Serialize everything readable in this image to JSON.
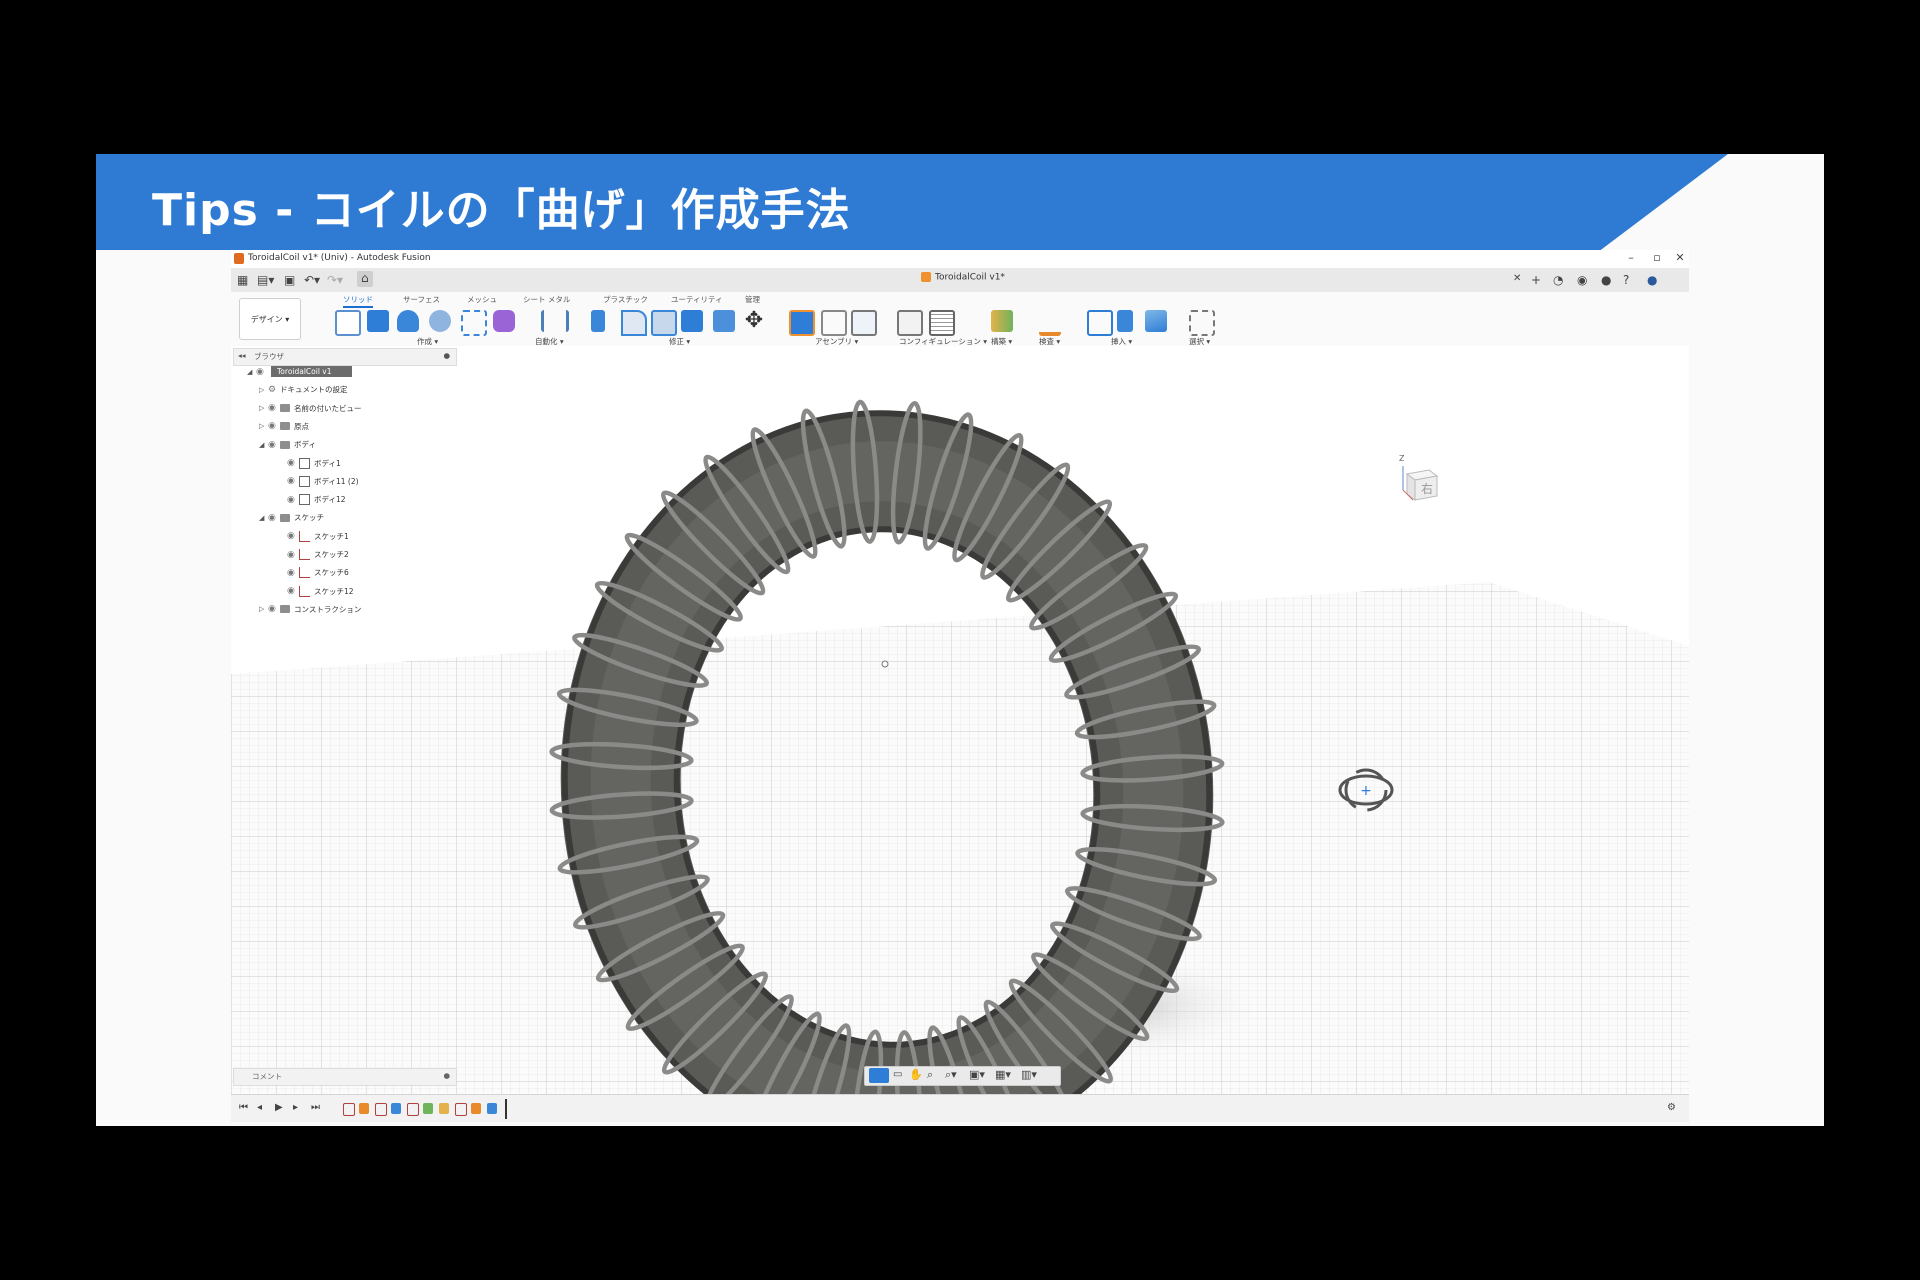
{
  "slide": {
    "title": "Tips - コイルの「曲げ」作成手法",
    "banner_color": "#2f7bd3"
  },
  "app": {
    "window_title": "ToroidalCoil v1* (Univ) - Autodesk Fusion",
    "document_tab": "ToroidalCoil v1*",
    "workspace": "デザイン ▾",
    "ribbon_tabs": [
      "ソリッド",
      "サーフェス",
      "メッシュ",
      "シート メタル",
      "プラスチック",
      "ユーティリティ",
      "管理"
    ],
    "active_tab": "ソリッド",
    "ribbon_groups": [
      "作成 ▾",
      "自動化 ▾",
      "修正 ▾",
      "アセンブリ ▾",
      "コンフィギュレーション ▾",
      "構築 ▾",
      "検査 ▾",
      "挿入 ▾",
      "選択 ▾"
    ]
  },
  "browser": {
    "header": "ブラウザ",
    "root": "ToroidalCoil v1",
    "items": [
      {
        "label": "ドキュメントの設定",
        "level": 1,
        "icon": "gear-icon"
      },
      {
        "label": "名前の付いたビュー",
        "level": 1,
        "icon": "folder-icon"
      },
      {
        "label": "原点",
        "level": 1,
        "icon": "folder-icon"
      },
      {
        "label": "ボディ",
        "level": 1,
        "icon": "folder-icon"
      },
      {
        "label": "ボディ1",
        "level": 2,
        "icon": "body-icon"
      },
      {
        "label": "ボディ11 (2)",
        "level": 2,
        "icon": "body-icon"
      },
      {
        "label": "ボディ12",
        "level": 2,
        "icon": "body-icon"
      },
      {
        "label": "スケッチ",
        "level": 1,
        "icon": "folder-icon"
      },
      {
        "label": "スケッチ1",
        "level": 2,
        "icon": "sketch-icon"
      },
      {
        "label": "スケッチ2",
        "level": 2,
        "icon": "sketch-icon"
      },
      {
        "label": "スケッチ6",
        "level": 2,
        "icon": "sketch-icon"
      },
      {
        "label": "スケッチ12",
        "level": 2,
        "icon": "sketch-icon"
      },
      {
        "label": "コンストラクション",
        "level": 1,
        "icon": "folder-icon"
      }
    ]
  },
  "viewcube": {
    "face_label": "右",
    "axis_label": "Z"
  },
  "comment_panel": {
    "label": "コメント"
  },
  "colors": {
    "torus": "#4a4a47",
    "coil": "#8a8a88",
    "accent": "#1c6fd1"
  }
}
